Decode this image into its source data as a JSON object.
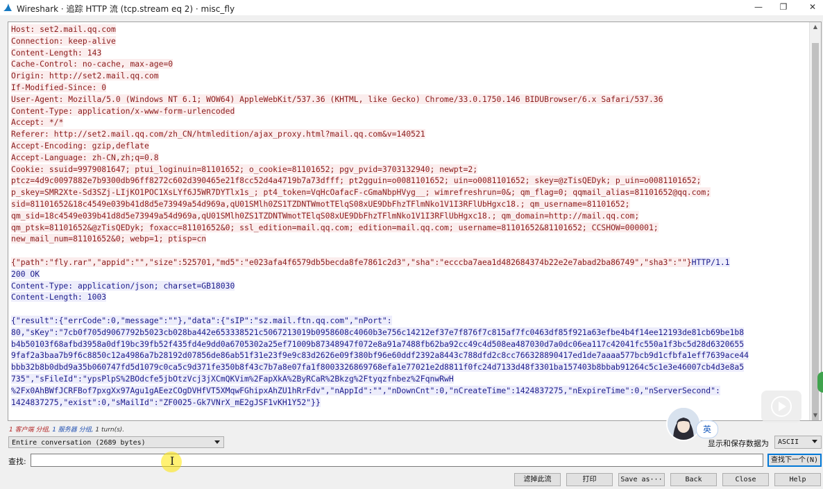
{
  "window": {
    "title": "Wireshark · 追踪 HTTP 流 (tcp.stream eq 2) · misc_fly",
    "minimize": "—",
    "maximize": "❐",
    "close": "✕"
  },
  "stream_lines": [
    {
      "t": "Host: set2.mail.qq.com",
      "k": "c"
    },
    {
      "t": "Connection: keep-alive",
      "k": "c"
    },
    {
      "t": "Content-Length: 143",
      "k": "c"
    },
    {
      "t": "Cache-Control: no-cache, max-age=0",
      "k": "c"
    },
    {
      "t": "Origin: http://set2.mail.qq.com",
      "k": "c"
    },
    {
      "t": "If-Modified-Since: 0",
      "k": "c"
    },
    {
      "t": "User-Agent: Mozilla/5.0 (Windows NT 6.1; WOW64) AppleWebKit/537.36 (KHTML, like Gecko) Chrome/33.0.1750.146 BIDUBrowser/6.x Safari/537.36",
      "k": "c"
    },
    {
      "t": "Content-Type: application/x-www-form-urlencoded",
      "k": "c"
    },
    {
      "t": "Accept: */*",
      "k": "c"
    },
    {
      "t": "Referer: http://set2.mail.qq.com/zh_CN/htmledition/ajax_proxy.html?mail.qq.com&v=140521",
      "k": "c"
    },
    {
      "t": "Accept-Encoding: gzip,deflate",
      "k": "c"
    },
    {
      "t": "Accept-Language: zh-CN,zh;q=0.8",
      "k": "c"
    },
    {
      "t": "Cookie: ssuid=9979081647; ptui_loginuin=81101652; o_cookie=81101652; pgv_pvid=3703132940; newpt=2;",
      "k": "c"
    },
    {
      "t": "ptcz=4d9c0097882e7b9300db96ff8272c602d390465e21f8cc52d4a4719b7a73dfff; pt2gguin=o0081101652; uin=o0081101652; skey=@zTisQEDyk; p_uin=o0081101652;",
      "k": "c"
    },
    {
      "t": "p_skey=SMR2Xte-Sd3SZj-LIjKO1POC1XsLYf6J5WR7DYTlx1s_; pt4_token=VqHcOafacF-cGmaNbpHVyg__; wimrefreshrun=0&; qm_flag=0; qqmail_alias=81101652@qq.com;",
      "k": "c"
    },
    {
      "t": "sid=81101652&18c4549e039b41d8d5e73949a54d969a,qU01SMlh0ZS1TZDNTWmotTElqS08xUE9DbFhzTFlmNko1V1I3RFlUbHgxc18.; qm_username=81101652;",
      "k": "c"
    },
    {
      "t": "qm_sid=18c4549e039b41d8d5e73949a54d969a,qU01SMlh0ZS1TZDNTWmotTElqS08xUE9DbFhzTFlmNko1V1I3RFlUbHgxc18.; qm_domain=http://mail.qq.com;",
      "k": "c"
    },
    {
      "t": "qm_ptsk=81101652&@zTisQEDyk; foxacc=81101652&0; ssl_edition=mail.qq.com; edition=mail.qq.com; username=81101652&81101652; CCSHOW=000001;",
      "k": "c"
    },
    {
      "t": "new_mail_num=81101652&0; webp=1; ptisp=cn",
      "k": "c"
    },
    {
      "t": "",
      "k": "n"
    },
    {
      "t": "{\"path\":\"fly.rar\",\"appid\":\"\",\"size\":525701,\"md5\":\"e023afa4f6579db5becda8fe7861c2d3\",\"sha\":\"ecccba7aea1d482684374b22e2e7abad2ba86749\",\"sha3\":\"\"}",
      "k": "c",
      "tail": "HTTP/1.1"
    },
    {
      "t": "200 OK",
      "k": "s"
    },
    {
      "t": "Content-Type: application/json; charset=GB18030",
      "k": "s"
    },
    {
      "t": "Content-Length: 1003",
      "k": "s"
    },
    {
      "t": "",
      "k": "n"
    },
    {
      "t": "{\"result\":{\"errCode\":0,\"message\":\"\"},\"data\":{\"sIP\":\"sz.mail.ftn.qq.com\",\"nPort\":",
      "k": "s"
    },
    {
      "t": "80,\"sKey\":\"7cb0f705d9067792b5023cb028ba442e653338521c5067213019b0958608c4060b3e756c14212ef37e7f876f7c815af7fc0463df85f921a63efbe4b4f14ee12193de81cb69be1b8",
      "k": "s"
    },
    {
      "t": "b4b50103f68afbd3958a0df19bc39fb52f435fd4e9dd0a6705302a25ef71009b87348947f072e8a91a7488fb62ba92cc49c4d508ea487030d7a0dc06ea117c42041fc550a1f3bc5d28d6320655",
      "k": "s"
    },
    {
      "t": "9faf2a3baa7b9f6c8850c12a4986a7b28192d07856de86ab51f31e23f9e9c83d2626e09f380bf96e60ddf2392a8443c788dfd2c8cc766328890417ed1de7aaaa577bcb9d1cfbfa1eff7639ace44",
      "k": "s"
    },
    {
      "t": "bbb32b8b0dbd9a35b060747fd5d1079c0ca5c9d371fe350b8f43c7b7a8e07fa1f8003326869768efa1e77021e2d8811f0fc24d7133d48f3301ba157403b8bbab91264c5c1e3e46007cb4d3e8a5",
      "k": "s"
    },
    {
      "t": "735\",\"sFileId\":\"ypsPlpS%2BOdcfe5jbOtzVcj3jXCmQKVim%2FapXkA%2ByRCaR%2Bkzg%2Ftyqzfnbez%2FqnwRwH",
      "k": "s"
    },
    {
      "t": "%2Fx0AhBWfJCRFBof7pxgXx97Agu1gAEezCOgDVHfVT5XMqwFGhipxAhZU1hRrFdv\",\"nAppId\":\"\",\"nDownCnt\":0,\"nCreateTime\":1424837275,\"nExpireTime\":0,\"nServerSecond\":",
      "k": "s"
    },
    {
      "t": "1424837275,\"exist\":0,\"sMailId\":\"ZF0025-Gk7VNrX_mE2gJSF1vKH1Y52\"}}",
      "k": "s"
    }
  ],
  "summary": {
    "client": "1 客户端 分组,",
    "server": "1 服务器 分组,",
    "turns": "1 turn(s)."
  },
  "conversation_select": "Entire conversation (2689 bytes)",
  "save_as_label": "显示和保存数据为",
  "format_select": "ASCII",
  "find_label": "查找:",
  "find_value": "",
  "find_next": "查找下一个(N)",
  "ime_label": "英",
  "buttons": {
    "filter_out": "滤掉此流",
    "print": "打印",
    "save_as": "Save as···",
    "back": "Back",
    "close": "Close",
    "help": "Help"
  },
  "colors": {
    "client_text": "#8b1a1a",
    "client_bg": "#fbeded",
    "server_text": "#1a1a8b",
    "server_bg": "#ededfb"
  }
}
